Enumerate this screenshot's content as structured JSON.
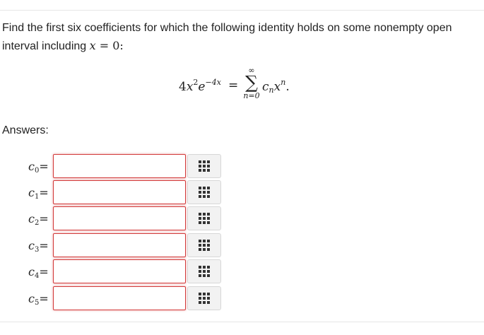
{
  "question": {
    "text_part1": "Find the first six coefficients for which the following identity holds on some nonempty open interval including ",
    "var_x": "x",
    "equals_zero": " = 0:"
  },
  "identity": {
    "lhs_coef": "4",
    "lhs_var": "x",
    "lhs_exp": "2",
    "lhs_e": "e",
    "lhs_e_exp": "−4x",
    "equals": "=",
    "sum_upper": "∞",
    "sum_symbol": "∑",
    "sum_lower": "n=0",
    "rhs_c": "c",
    "rhs_sub": "n",
    "rhs_x": "x",
    "rhs_sup": "n",
    "rhs_end": "."
  },
  "answers_label": "Answers:",
  "rows": [
    {
      "var": "c",
      "index": "0",
      "eq": "=",
      "value": ""
    },
    {
      "var": "c",
      "index": "1",
      "eq": "=",
      "value": ""
    },
    {
      "var": "c",
      "index": "2",
      "eq": "=",
      "value": ""
    },
    {
      "var": "c",
      "index": "3",
      "eq": "=",
      "value": ""
    },
    {
      "var": "c",
      "index": "4",
      "eq": "=",
      "value": ""
    },
    {
      "var": "c",
      "index": "5",
      "eq": "=",
      "value": ""
    }
  ],
  "button_icon": "grid-icon"
}
